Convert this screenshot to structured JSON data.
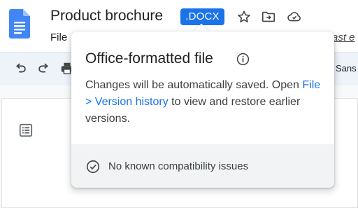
{
  "header": {
    "doc_title": "Product brochure",
    "format_badge": ".DOCX",
    "menu_file": "File",
    "last_edit_fragment": "ast e"
  },
  "header_icons": [
    "google-docs-logo-icon",
    "star-icon",
    "move-to-folder-icon",
    "cloud-saved-icon"
  ],
  "toolbar": {
    "icons": [
      "undo-icon",
      "redo-icon",
      "print-icon"
    ],
    "font_fragment": "Sans"
  },
  "popover": {
    "title": "Office-formatted file",
    "body_before_link": "Changes will be automatically saved. Open ",
    "link_text": "File > Version history",
    "body_after_link": " to view and restore earlier versions.",
    "footer_text": "No known compatibility issues"
  },
  "colors": {
    "accent": "#1a73e8",
    "toolbar_bg": "#eef2f9",
    "footer_bg": "#f1f3f4",
    "text": "#202124"
  }
}
